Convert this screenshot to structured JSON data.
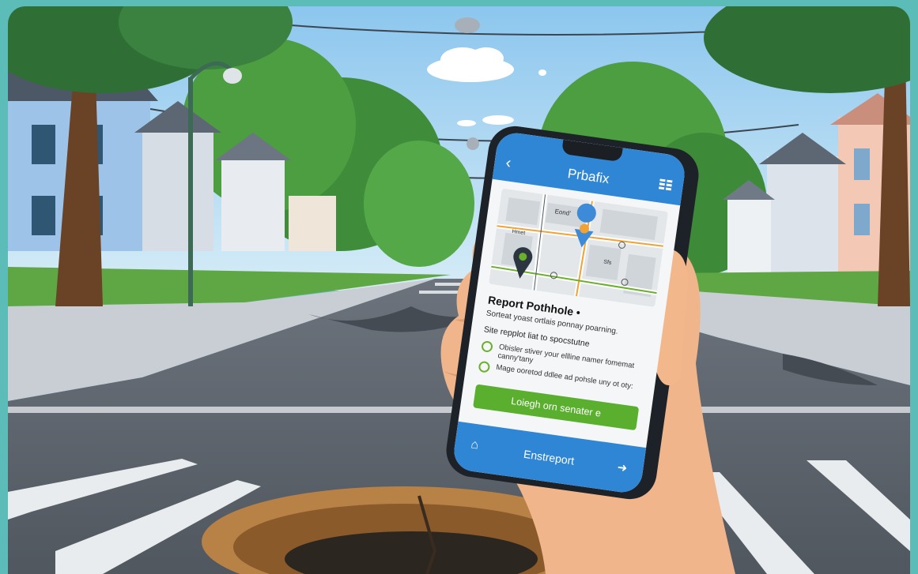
{
  "colors": {
    "border": "#5bbcb8",
    "sky": "#a9d6f2",
    "road": "#5f6670",
    "app_blue": "#2f86d4",
    "cta_green": "#5aaf2e",
    "pin_orange": "#f0a234",
    "pin_blue": "#3c8ad8",
    "pin_dark": "#2b3640"
  },
  "app": {
    "title": "Prbafix",
    "back_icon": "chevron-left-icon",
    "menu_icon": "grid-menu-icon"
  },
  "map": {
    "labels": [
      "Eond'",
      "Hmet",
      "Sfs"
    ]
  },
  "report": {
    "title": "Report Pothhole •",
    "subtitle": "Sorteat yoast ortlais ponnay poarning.",
    "section": "Site repplot liat to spocstutne",
    "options": [
      {
        "text": "Obisler stiver your ellline namer fomemat canny'tany"
      },
      {
        "text": "Mage ooretod ddlee ad pohsle uny ot oty:"
      }
    ],
    "cta_label": "Loiegh orn senater e"
  },
  "bottom_bar": {
    "home_icon": "home-icon",
    "label": "Enstreport",
    "share_icon": "share-icon"
  }
}
